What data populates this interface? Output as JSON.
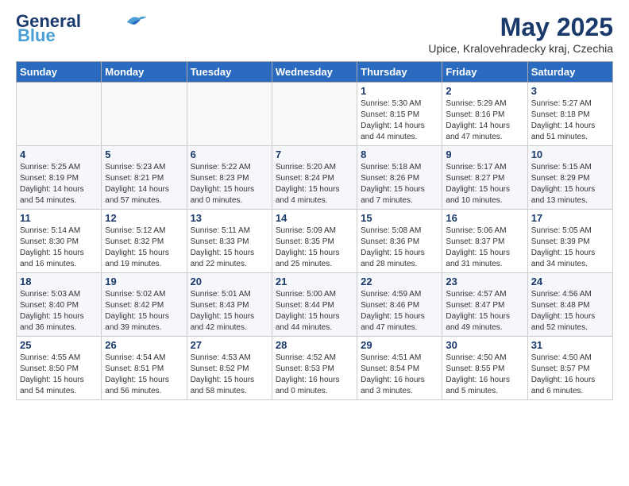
{
  "header": {
    "logo_line1": "General",
    "logo_line2": "Blue",
    "month_year": "May 2025",
    "location": "Upice, Kralovehradecky kraj, Czechia"
  },
  "days_of_week": [
    "Sunday",
    "Monday",
    "Tuesday",
    "Wednesday",
    "Thursday",
    "Friday",
    "Saturday"
  ],
  "weeks": [
    [
      {
        "day": "",
        "info": ""
      },
      {
        "day": "",
        "info": ""
      },
      {
        "day": "",
        "info": ""
      },
      {
        "day": "",
        "info": ""
      },
      {
        "day": "1",
        "info": "Sunrise: 5:30 AM\nSunset: 8:15 PM\nDaylight: 14 hours\nand 44 minutes."
      },
      {
        "day": "2",
        "info": "Sunrise: 5:29 AM\nSunset: 8:16 PM\nDaylight: 14 hours\nand 47 minutes."
      },
      {
        "day": "3",
        "info": "Sunrise: 5:27 AM\nSunset: 8:18 PM\nDaylight: 14 hours\nand 51 minutes."
      }
    ],
    [
      {
        "day": "4",
        "info": "Sunrise: 5:25 AM\nSunset: 8:19 PM\nDaylight: 14 hours\nand 54 minutes."
      },
      {
        "day": "5",
        "info": "Sunrise: 5:23 AM\nSunset: 8:21 PM\nDaylight: 14 hours\nand 57 minutes."
      },
      {
        "day": "6",
        "info": "Sunrise: 5:22 AM\nSunset: 8:23 PM\nDaylight: 15 hours\nand 0 minutes."
      },
      {
        "day": "7",
        "info": "Sunrise: 5:20 AM\nSunset: 8:24 PM\nDaylight: 15 hours\nand 4 minutes."
      },
      {
        "day": "8",
        "info": "Sunrise: 5:18 AM\nSunset: 8:26 PM\nDaylight: 15 hours\nand 7 minutes."
      },
      {
        "day": "9",
        "info": "Sunrise: 5:17 AM\nSunset: 8:27 PM\nDaylight: 15 hours\nand 10 minutes."
      },
      {
        "day": "10",
        "info": "Sunrise: 5:15 AM\nSunset: 8:29 PM\nDaylight: 15 hours\nand 13 minutes."
      }
    ],
    [
      {
        "day": "11",
        "info": "Sunrise: 5:14 AM\nSunset: 8:30 PM\nDaylight: 15 hours\nand 16 minutes."
      },
      {
        "day": "12",
        "info": "Sunrise: 5:12 AM\nSunset: 8:32 PM\nDaylight: 15 hours\nand 19 minutes."
      },
      {
        "day": "13",
        "info": "Sunrise: 5:11 AM\nSunset: 8:33 PM\nDaylight: 15 hours\nand 22 minutes."
      },
      {
        "day": "14",
        "info": "Sunrise: 5:09 AM\nSunset: 8:35 PM\nDaylight: 15 hours\nand 25 minutes."
      },
      {
        "day": "15",
        "info": "Sunrise: 5:08 AM\nSunset: 8:36 PM\nDaylight: 15 hours\nand 28 minutes."
      },
      {
        "day": "16",
        "info": "Sunrise: 5:06 AM\nSunset: 8:37 PM\nDaylight: 15 hours\nand 31 minutes."
      },
      {
        "day": "17",
        "info": "Sunrise: 5:05 AM\nSunset: 8:39 PM\nDaylight: 15 hours\nand 34 minutes."
      }
    ],
    [
      {
        "day": "18",
        "info": "Sunrise: 5:03 AM\nSunset: 8:40 PM\nDaylight: 15 hours\nand 36 minutes."
      },
      {
        "day": "19",
        "info": "Sunrise: 5:02 AM\nSunset: 8:42 PM\nDaylight: 15 hours\nand 39 minutes."
      },
      {
        "day": "20",
        "info": "Sunrise: 5:01 AM\nSunset: 8:43 PM\nDaylight: 15 hours\nand 42 minutes."
      },
      {
        "day": "21",
        "info": "Sunrise: 5:00 AM\nSunset: 8:44 PM\nDaylight: 15 hours\nand 44 minutes."
      },
      {
        "day": "22",
        "info": "Sunrise: 4:59 AM\nSunset: 8:46 PM\nDaylight: 15 hours\nand 47 minutes."
      },
      {
        "day": "23",
        "info": "Sunrise: 4:57 AM\nSunset: 8:47 PM\nDaylight: 15 hours\nand 49 minutes."
      },
      {
        "day": "24",
        "info": "Sunrise: 4:56 AM\nSunset: 8:48 PM\nDaylight: 15 hours\nand 52 minutes."
      }
    ],
    [
      {
        "day": "25",
        "info": "Sunrise: 4:55 AM\nSunset: 8:50 PM\nDaylight: 15 hours\nand 54 minutes."
      },
      {
        "day": "26",
        "info": "Sunrise: 4:54 AM\nSunset: 8:51 PM\nDaylight: 15 hours\nand 56 minutes."
      },
      {
        "day": "27",
        "info": "Sunrise: 4:53 AM\nSunset: 8:52 PM\nDaylight: 15 hours\nand 58 minutes."
      },
      {
        "day": "28",
        "info": "Sunrise: 4:52 AM\nSunset: 8:53 PM\nDaylight: 16 hours\nand 0 minutes."
      },
      {
        "day": "29",
        "info": "Sunrise: 4:51 AM\nSunset: 8:54 PM\nDaylight: 16 hours\nand 3 minutes."
      },
      {
        "day": "30",
        "info": "Sunrise: 4:50 AM\nSunset: 8:55 PM\nDaylight: 16 hours\nand 5 minutes."
      },
      {
        "day": "31",
        "info": "Sunrise: 4:50 AM\nSunset: 8:57 PM\nDaylight: 16 hours\nand 6 minutes."
      }
    ]
  ]
}
